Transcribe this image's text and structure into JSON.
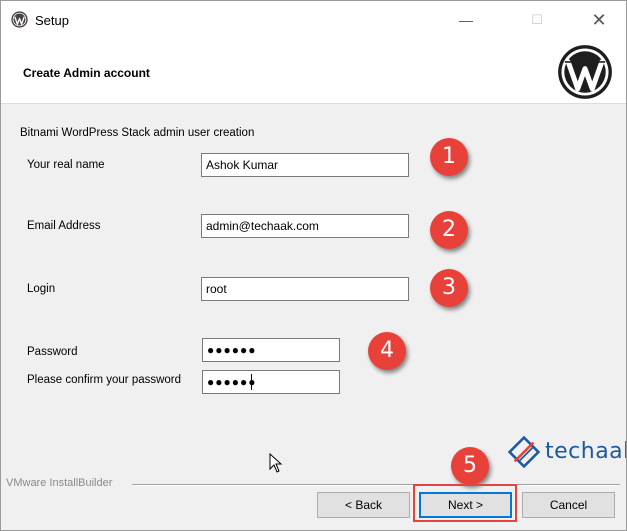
{
  "window": {
    "title": "Setup",
    "minimize_glyph": "—",
    "maximize_glyph": "☐",
    "close_glyph": "✕"
  },
  "header": {
    "title": "Create Admin account"
  },
  "form": {
    "section_label": "Bitnami WordPress Stack admin user creation",
    "real_name": {
      "label": "Your real name",
      "value": "Ashok Kumar"
    },
    "email": {
      "label": "Email Address",
      "value": "admin@techaak.com"
    },
    "login": {
      "label": "Login",
      "value": "root"
    },
    "password": {
      "label": "Password",
      "value": "●●●●●●"
    },
    "confirm_password": {
      "label": "Please confirm your password",
      "value": "●●●●●●"
    }
  },
  "annotations": {
    "badges": [
      "1",
      "2",
      "3",
      "4",
      "5"
    ],
    "badge_color": "#e8413a",
    "highlight_color": "#e0453f"
  },
  "brand": {
    "text": "techaak",
    "color": "#1b5aa0"
  },
  "footer": {
    "vendor": "VMware InstallBuilder",
    "back_label": "< Back",
    "next_label": "Next >",
    "cancel_label": "Cancel"
  },
  "icons": {
    "app": "wordpress-icon",
    "header_logo": "wordpress-logo-icon",
    "brand": "techaak-logo-icon",
    "pointer": "mouse-pointer-icon"
  }
}
